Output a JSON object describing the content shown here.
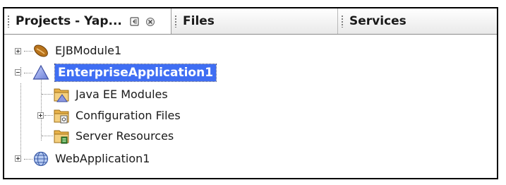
{
  "tabs": [
    {
      "label": "Projects - Yap...",
      "active": true
    },
    {
      "label": "Files",
      "active": false
    },
    {
      "label": "Services",
      "active": false
    }
  ],
  "tree": {
    "ejb_module": {
      "label": "EJBModule1",
      "icon": "ejb-bean-icon"
    },
    "enterprise_app": {
      "label": "EnterpriseApplication1",
      "icon": "enterprise-app-icon",
      "selected": true
    },
    "java_ee_modules": {
      "label": "Java EE Modules",
      "icon": "java-ee-modules-folder-icon"
    },
    "config_files": {
      "label": "Configuration Files",
      "icon": "configuration-files-folder-icon"
    },
    "server_resources": {
      "label": "Server Resources",
      "icon": "server-resources-folder-icon"
    },
    "web_app": {
      "label": "WebApplication1",
      "icon": "web-app-globe-icon"
    }
  },
  "colors": {
    "selection": "#3f6ef3",
    "tab_bg": "#e9e9e9",
    "folder": "#e8b24a"
  }
}
